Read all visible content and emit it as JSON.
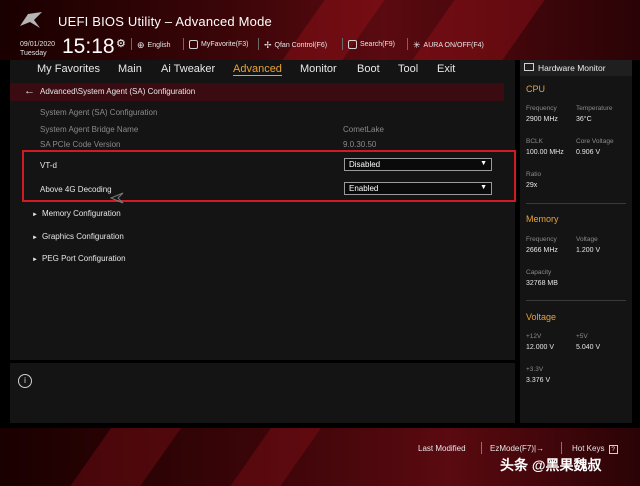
{
  "header": {
    "title": "UEFI BIOS Utility – Advanced Mode",
    "date": "09/01/2020",
    "day": "Tuesday",
    "time": "15:18",
    "tools": {
      "language": "English",
      "myfavorite": "MyFavorite(F3)",
      "qfan": "Qfan Control(F6)",
      "search": "Search(F9)",
      "aura": "AURA ON/OFF(F4)"
    }
  },
  "menu": {
    "items": [
      "My Favorites",
      "Main",
      "Ai Tweaker",
      "Advanced",
      "Monitor",
      "Boot",
      "Tool",
      "Exit"
    ],
    "active": "Advanced"
  },
  "breadcrumb": "Advanced\\System Agent (SA) Configuration",
  "settings": {
    "section_title": "System Agent (SA) Configuration",
    "bridge_label": "System Agent Bridge Name",
    "bridge_value": "CometLake",
    "pcie_label": "SA PCIe Code Version",
    "pcie_value": "9.0.30.50",
    "vtd_label": "VT-d",
    "vtd_value": "Disabled",
    "above4g_label": "Above 4G Decoding",
    "above4g_value": "Enabled"
  },
  "submenus": [
    "Memory Configuration",
    "Graphics Configuration",
    "PEG Port Configuration"
  ],
  "info_icon": "i",
  "hw": {
    "title": "Hardware Monitor",
    "cpu": {
      "heading": "CPU",
      "freq_label": "Frequency",
      "freq": "2900 MHz",
      "temp_label": "Temperature",
      "temp": "36°C",
      "bclk_label": "BCLK",
      "bclk": "100.00 MHz",
      "vcore_label": "Core Voltage",
      "vcore": "0.906 V",
      "ratio_label": "Ratio",
      "ratio": "29x"
    },
    "memory": {
      "heading": "Memory",
      "freq_label": "Frequency",
      "freq": "2666 MHz",
      "volt_label": "Voltage",
      "volt": "1.200 V",
      "cap_label": "Capacity",
      "cap": "32768 MB"
    },
    "voltage": {
      "heading": "Voltage",
      "v12_label": "+12V",
      "v12": "12.000 V",
      "v5_label": "+5V",
      "v5": "5.040 V",
      "v33_label": "+3.3V",
      "v33": "3.376 V"
    }
  },
  "footer": {
    "last_modified": "Last Modified",
    "ezmode": "EzMode(F7)|→",
    "hotkeys": "Hot Keys",
    "hotkeys_icon": "?",
    "watermark": "头条 @黑果魏叔"
  },
  "colors": {
    "accent": "#e8a23a",
    "highlight_border": "#d01a24",
    "header_red": "#5a0a10"
  }
}
